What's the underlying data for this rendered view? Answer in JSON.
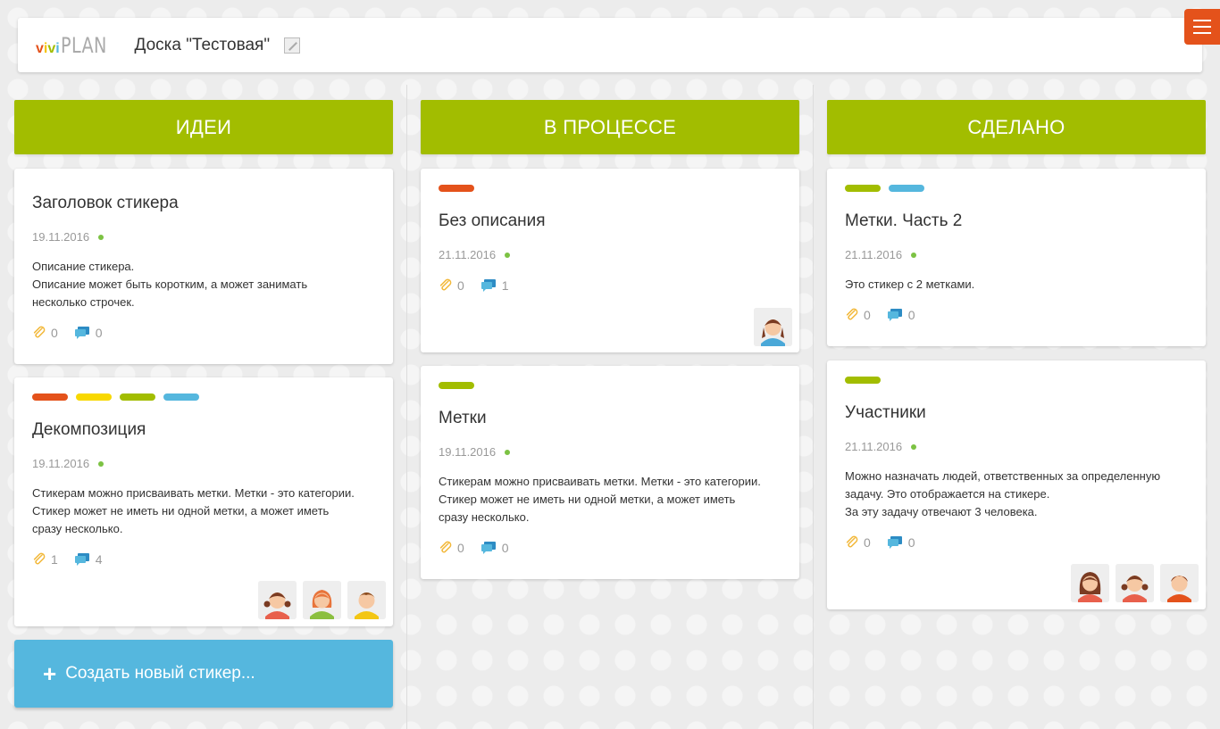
{
  "header": {
    "logo_letters": [
      "v",
      "i",
      "v",
      "i"
    ],
    "logo_colors": [
      "#e4521b",
      "#f5c400",
      "#a2bd00",
      "#55b7de"
    ],
    "logo_plan": "PLAN",
    "board_title": "Доска \"Тестовая\""
  },
  "colors": {
    "orange": "#e4521b",
    "yellow": "#f8d800",
    "green": "#a2bd00",
    "blue": "#55b7de"
  },
  "columns": [
    {
      "title": "ИДЕИ",
      "create_label": "Создать новый стикер...",
      "cards": [
        {
          "title": "Заголовок стикера",
          "date": "19.11.2016",
          "description": [
            "Описание стикера.",
            "Описание может быть коротким, а может занимать",
            "несколько строчек."
          ],
          "attachments": "0",
          "comments": "0",
          "labels": [],
          "avatars": []
        },
        {
          "title": "Декомпозиция",
          "date": "19.11.2016",
          "description": [
            "Стикерам можно присваивать метки. Метки - это категории.",
            "Стикер может не иметь ни одной метки, а может иметь",
            "сразу несколько."
          ],
          "attachments": "1",
          "comments": "4",
          "labels": [
            "orange",
            "yellow",
            "green",
            "blue"
          ],
          "avatars": [
            "girl-pigtails",
            "girl-red",
            "boy-yellow"
          ]
        }
      ]
    },
    {
      "title": "В ПРОЦЕССЕ",
      "cards": [
        {
          "title": "Без описания",
          "date": "21.11.2016",
          "description": [],
          "attachments": "0",
          "comments": "1",
          "labels": [
            "orange"
          ],
          "avatars": [
            "girl-blue"
          ]
        },
        {
          "title": "Метки",
          "date": "19.11.2016",
          "description": [
            "Стикерам можно присваивать метки. Метки - это категории.",
            "Стикер может не иметь ни одной метки, а может иметь",
            "сразу несколько."
          ],
          "attachments": "0",
          "comments": "0",
          "labels": [
            "green"
          ],
          "avatars": []
        }
      ]
    },
    {
      "title": "СДЕЛАНО",
      "cards": [
        {
          "title": "Метки. Часть 2",
          "date": "21.11.2016",
          "description": [
            "Это стикер с 2 метками."
          ],
          "attachments": "0",
          "comments": "0",
          "labels": [
            "green",
            "blue"
          ],
          "avatars": []
        },
        {
          "title": "Участники",
          "date": "21.11.2016",
          "description": [
            "Можно назначать людей, ответственных за определенную",
            "задачу. Это отображается на стикере.",
            "За эту задачу отвечают 3 человека."
          ],
          "attachments": "0",
          "comments": "0",
          "labels": [
            "green"
          ],
          "avatars": [
            "woman-brown",
            "girl-pigtails",
            "man-brown"
          ]
        }
      ]
    }
  ]
}
